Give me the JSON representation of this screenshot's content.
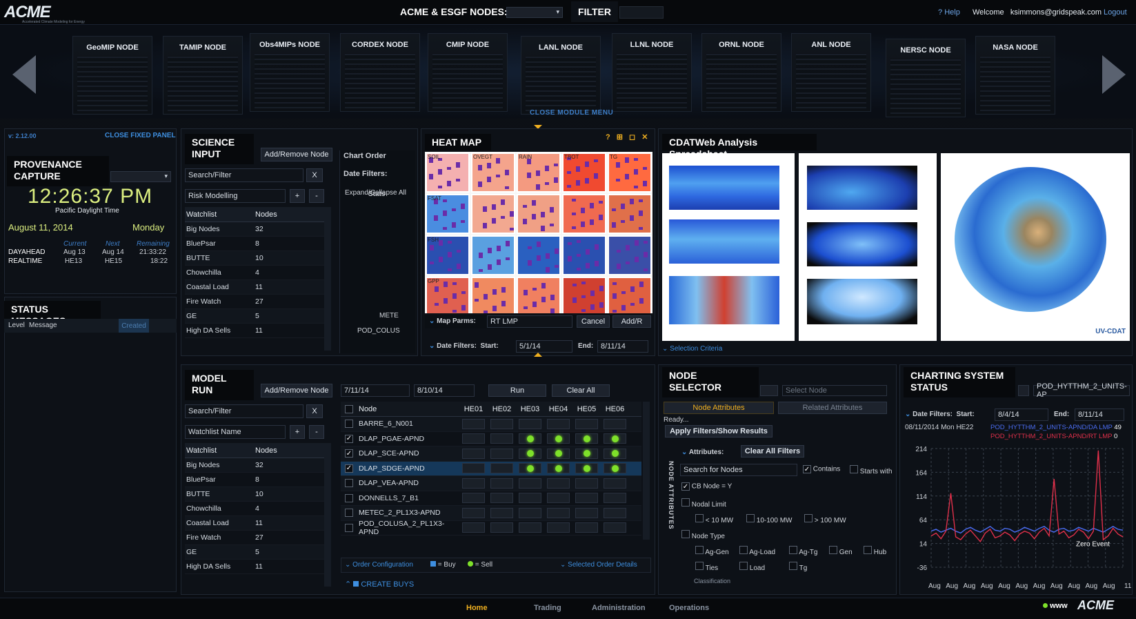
{
  "header": {
    "logo": "ACME",
    "logo_sub": "Accelerated Climate Modeling for Energy",
    "nodes_title": "ACME & ESGF NODES:",
    "filter_label": "FILTER",
    "help": "Help",
    "welcome": "Welcome",
    "user": "ksimmons@gridspeak.com",
    "logout": "Logout"
  },
  "carousel": {
    "nodes": [
      "GeoMIP NODE",
      "TAMIP NODE",
      "Obs4MIPs NODE",
      "CORDEX NODE",
      "CMIP NODE",
      "LANL NODE",
      "LLNL NODE",
      "ORNL NODE",
      "ANL NODE",
      "NERSC NODE",
      "NASA NODE"
    ],
    "close_label": "CLOSE MODULE MENU"
  },
  "left": {
    "version": "v: 2.12.00",
    "close_fixed": "CLOSE FIXED PANEL",
    "prov_title_1": "PROVENANCE",
    "prov_title_2": "CAPTURE",
    "time": "12:26:37 PM",
    "tz": "Pacific Daylight Time",
    "date": "August 11, 2014",
    "day": "Monday",
    "cols": [
      "Current",
      "Next",
      "Remaining"
    ],
    "rows": [
      {
        "label": "DAYAHEAD",
        "current": "Aug 13",
        "next": "Aug 14",
        "remaining": "21:33:22"
      },
      {
        "label": "REALTIME",
        "current": "HE13",
        "next": "HE15",
        "remaining": "18:22"
      }
    ],
    "status_title": "STATUS MESSAGES",
    "status_cols": [
      "Level",
      "Message",
      "Created"
    ]
  },
  "science": {
    "title_1": "SCIENCE",
    "title_2": "INPUT",
    "add_remove": "Add/Remove Node",
    "search": "Search/Filter",
    "x": "X",
    "risk": "Risk Modelling",
    "plus": "+",
    "minus": "-",
    "col_watch": "Watchlist",
    "col_nodes": "Nodes",
    "rows": [
      [
        "Big Nodes",
        "32"
      ],
      [
        "BluePsar",
        "8"
      ],
      [
        "BUTTE",
        "10"
      ],
      [
        "Chowchilla",
        "4"
      ],
      [
        "Coastal Load",
        "11"
      ],
      [
        "Fire Watch",
        "27"
      ],
      [
        "GE",
        "5"
      ],
      [
        "High DA Sells",
        "11"
      ]
    ],
    "chart_order": "Chart Order",
    "date_filters": "Date Filters:",
    "expand": "Expand/Collapse All",
    "stats": "Stats",
    "side_items": [
      "METE",
      "POD_COLUS"
    ]
  },
  "heatmap": {
    "title": "HEAT MAP",
    "labels": [
      "SOIL",
      "OVEGT",
      "RAIN",
      "TBOT",
      "TG",
      "FSAT",
      "FSH",
      "GPP"
    ],
    "map_parms": "Map Parms:",
    "parm_value": "RT LMP",
    "cancel": "Cancel",
    "addr": "Add/R",
    "date_filters": "Date Filters:",
    "start_label": "Start:",
    "start": "5/1/14",
    "end_label": "End:",
    "end": "8/11/14",
    "icons": "? ⊞ ◻ ✕"
  },
  "cdat": {
    "title": "CDATWeb Analysis Spreadsheet",
    "selection": "Selection Criteria",
    "brand": "UV-CDAT"
  },
  "model": {
    "title_1": "MODEL",
    "title_2": "RUN",
    "add_remove": "Add/Remove Node",
    "search": "Search/Filter",
    "x": "X",
    "watchlist_name": "Watchlist Name",
    "plus": "+",
    "minus": "-",
    "col_watch": "Watchlist",
    "col_nodes": "Nodes",
    "rows": [
      [
        "Big Nodes",
        "32"
      ],
      [
        "BluePsar",
        "8"
      ],
      [
        "BUTTE",
        "10"
      ],
      [
        "Chowchilla",
        "4"
      ],
      [
        "Coastal Load",
        "11"
      ],
      [
        "Fire Watch",
        "27"
      ],
      [
        "GE",
        "5"
      ],
      [
        "High DA Sells",
        "11"
      ]
    ],
    "date_from": "7/11/14",
    "date_to": "8/10/14",
    "run": "Run",
    "clear_all": "Clear All",
    "node_col": "Node",
    "he_cols": [
      "HE01",
      "HE02",
      "HE03",
      "HE04",
      "HE05",
      "HE06"
    ],
    "node_rows": [
      {
        "name": "BARRE_6_N001",
        "checked": false,
        "leds": false
      },
      {
        "name": "DLAP_PGAE-APND",
        "checked": true,
        "leds": true
      },
      {
        "name": "DLAP_SCE-APND",
        "checked": true,
        "leds": true
      },
      {
        "name": "DLAP_SDGE-APND",
        "checked": true,
        "leds": true
      },
      {
        "name": "DLAP_VEA-APND",
        "checked": false,
        "leds": false
      },
      {
        "name": "DONNELLS_7_B1",
        "checked": false,
        "leds": false
      },
      {
        "name": "METEC_2_PL1X3-APND",
        "checked": false,
        "leds": false
      },
      {
        "name": "POD_COLUSA_2_PL1X3-APND",
        "checked": false,
        "leds": false
      }
    ],
    "order_config": "Order Configuration",
    "buy": "= Buy",
    "sell": "= Sell",
    "selected_order": "Selected Order Details",
    "create_buys": "CREATE BUYS"
  },
  "selector": {
    "title_1": "NODE",
    "title_2": "SELECTOR",
    "select_node": "Select Node",
    "tab_node_attrs": "Node Attributes",
    "tab_related": "Related Attributes",
    "ready": "Ready...",
    "apply": "Apply Filters/Show Results",
    "attributes": "Attributes:",
    "clear_filters": "Clear All Filters",
    "search_nodes": "Search for Nodes",
    "contains": "Contains",
    "starts_with": "Starts with",
    "cb_node": "CB Node = Y",
    "nodal_limit": "Nodal Limit",
    "limits": [
      "< 10 MW",
      "10-100 MW",
      "> 100 MW"
    ],
    "node_type": "Node Type",
    "types_row1": [
      "Ag-Gen",
      "Ag-Load",
      "Ag-Tg",
      "Gen",
      "Hub"
    ],
    "types_row2": [
      "Ties",
      "Load",
      "Tg"
    ],
    "classification": "Classification",
    "side_label": "NODE ATTRIBUTES"
  },
  "charting": {
    "title_1": "CHARTING SYSTEM",
    "title_2": "STATUS",
    "series_select": "POD_HYTTHM_2_UNITS-AP",
    "date_filters": "Date Filters:",
    "start_label": "Start:",
    "start": "8/4/14",
    "end_label": "End:",
    "end": "8/11/14",
    "stamp": "08/11/2014 Mon HE22",
    "legend": [
      {
        "name": "POD_HYTTHM_2_UNITS-APND/DA LMP",
        "value": "49",
        "color": "#4a6cf0"
      },
      {
        "name": "POD_HYTTHM_2_UNITS-APND/RT LMP",
        "value": "0",
        "color": "#e0304a"
      }
    ],
    "annotation": "Zero Event"
  },
  "chart_data": {
    "type": "line",
    "yticks": [
      "214",
      "164",
      "114",
      "64",
      "14",
      "-36"
    ],
    "ylim": [
      -36,
      214
    ],
    "xticks": [
      "Aug",
      "Aug",
      "Aug",
      "Aug",
      "Aug",
      "Aug",
      "Aug",
      "Aug",
      "Aug",
      "Aug",
      "Aug"
    ],
    "last_xtick": "11",
    "series": [
      {
        "name": "POD_HYTTHM_2_UNITS-APND/DA LMP",
        "color": "#4a6cf0",
        "values": [
          40,
          44,
          38,
          42,
          46,
          40,
          36,
          44,
          48,
          42,
          38,
          44,
          50,
          42,
          40,
          46,
          44,
          38,
          42,
          48,
          44,
          40,
          46,
          50,
          42,
          38,
          44,
          46,
          40,
          42,
          48,
          44,
          40,
          46,
          42,
          38,
          44,
          50,
          44,
          42
        ]
      },
      {
        "name": "POD_HYTTHM_2_UNITS-APND/RT LMP",
        "color": "#e0304a",
        "values": [
          30,
          36,
          24,
          40,
          120,
          28,
          22,
          34,
          42,
          30,
          18,
          36,
          44,
          26,
          30,
          38,
          32,
          20,
          34,
          40,
          36,
          24,
          38,
          46,
          30,
          150,
          34,
          40,
          26,
          32,
          44,
          38,
          24,
          40,
          210,
          22,
          30,
          46,
          34,
          28
        ]
      }
    ]
  },
  "footer": {
    "tabs": [
      "Home",
      "Trading",
      "Administration",
      "Operations"
    ],
    "www": "www",
    "logo": "ACME"
  }
}
